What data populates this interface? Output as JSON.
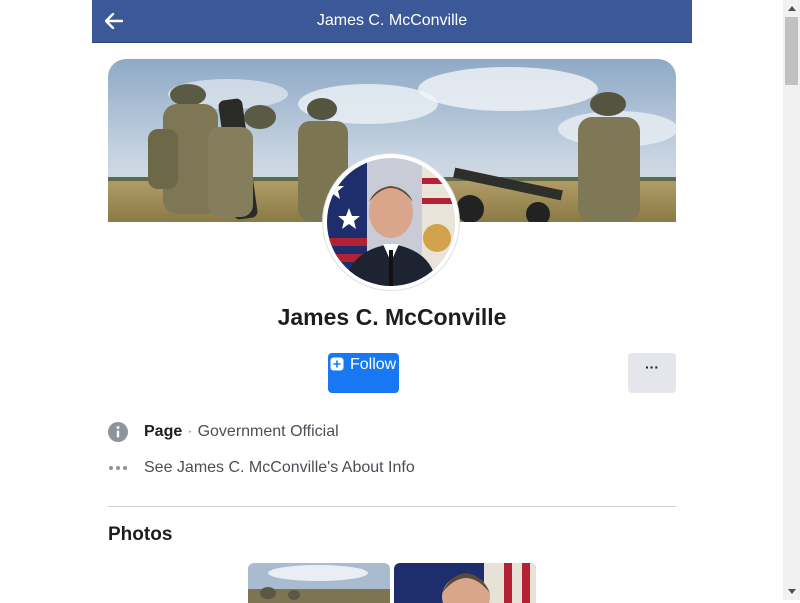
{
  "header": {
    "title": "James C. McConville",
    "back_icon": "arrow-left-icon",
    "background": "#3b5998"
  },
  "profile": {
    "name": "James C. McConville",
    "cover_description": "soldiers-with-howitzer",
    "avatar_description": "portrait-in-uniform"
  },
  "actions": {
    "follow_label": "Follow",
    "follow_icon": "plus-square-icon",
    "more_label": "···",
    "follow_color": "#1877f2"
  },
  "info": {
    "page_label": "Page",
    "page_separator": "·",
    "page_category": "Government Official",
    "about_link": "See James C. McConville's About Info",
    "page_icon": "info-circle-icon",
    "about_icon": "more-horizontal-icon"
  },
  "photos": {
    "title": "Photos"
  }
}
